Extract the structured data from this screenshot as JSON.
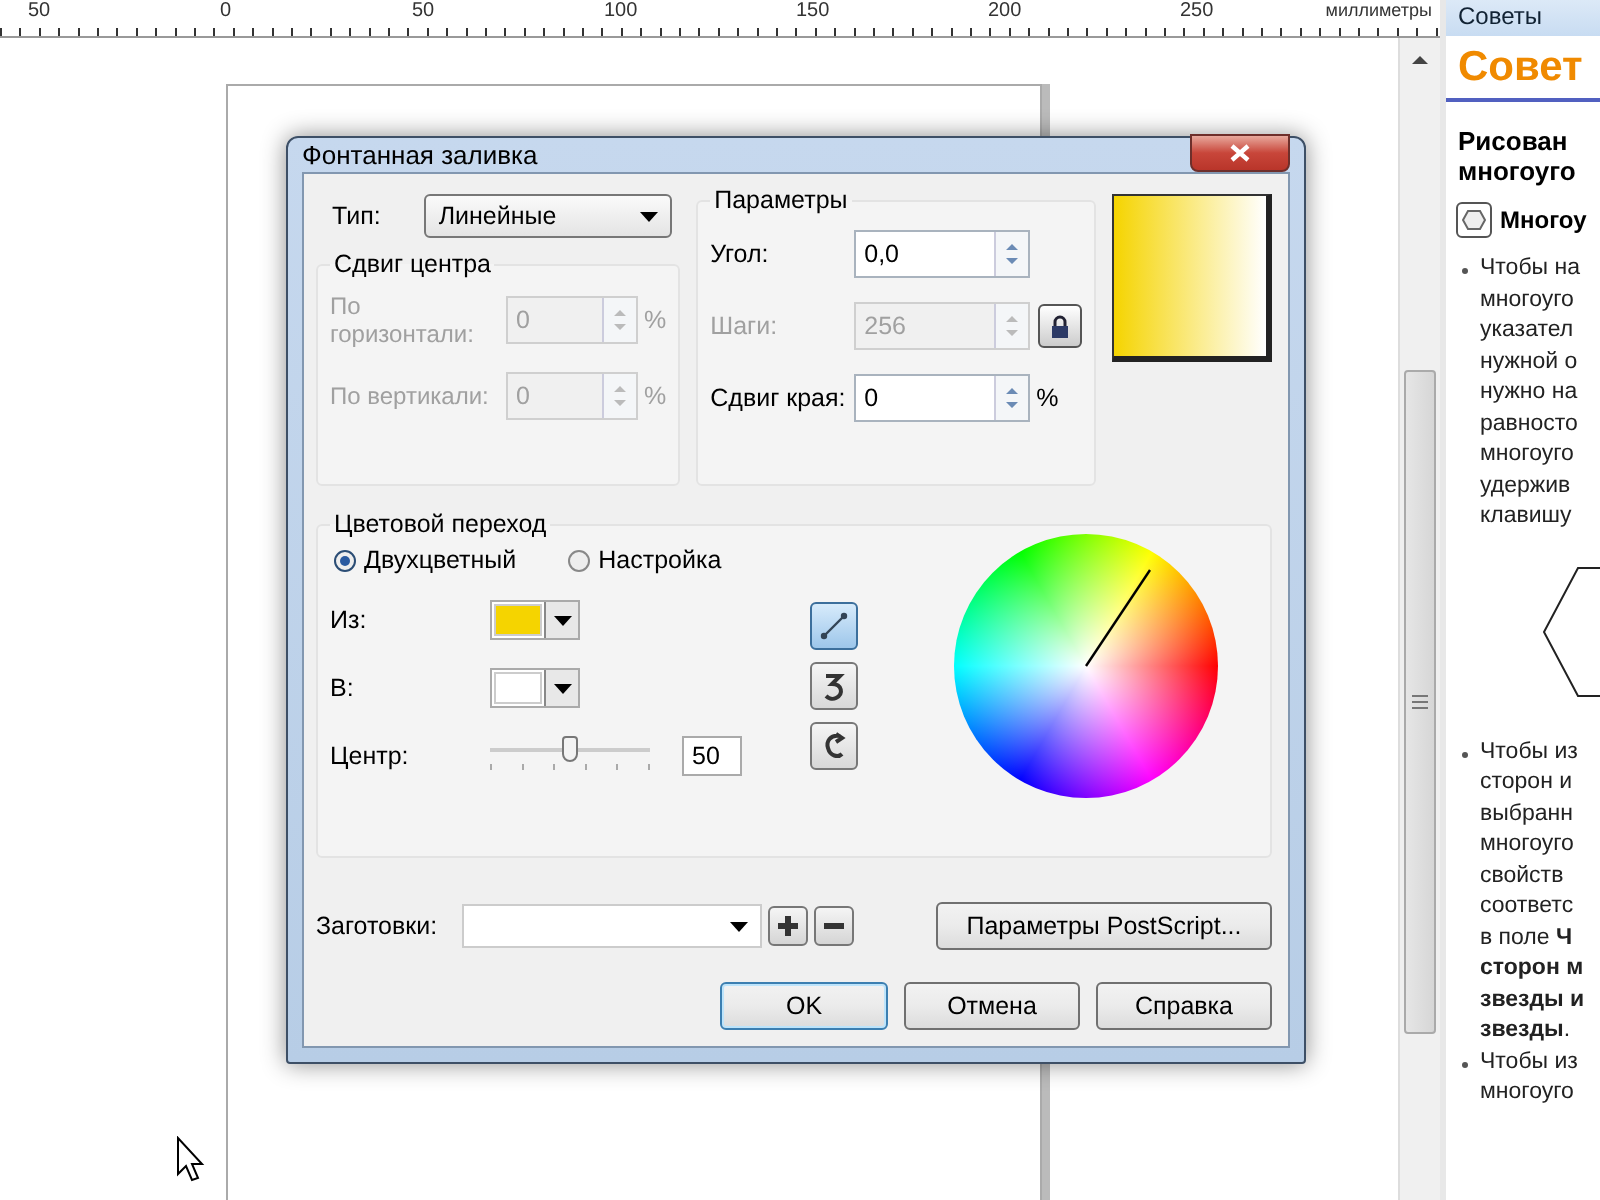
{
  "ruler": {
    "labels": [
      "50",
      "0",
      "50",
      "100",
      "150",
      "200",
      "250"
    ],
    "unit": "миллиметры"
  },
  "tips_panel": {
    "title": "Советы",
    "heading": "Совет",
    "subheading": [
      "Рисован",
      "многоуго"
    ],
    "tool": "Многоу",
    "bullets": [
      {
        "lines": [
          "Чтобы на",
          "многоуго",
          "указател",
          "нужной о",
          "нужно на",
          "равносто",
          "многоуго",
          "удержив",
          "клавишу"
        ]
      },
      {
        "lines": [
          "Чтобы из",
          "сторон и",
          "выбранн",
          "многоуго",
          "свойств",
          "соответс",
          "в поле **Ч**",
          "**сторон м**",
          "**звезды и**",
          "**звезды**."
        ]
      },
      {
        "lines": [
          "Чтобы из",
          "многоуго"
        ]
      }
    ]
  },
  "dialog": {
    "title": "Фонтанная заливка",
    "type": {
      "label": "Тип:",
      "value": "Линейные"
    },
    "center_offset": {
      "title": "Сдвиг центра",
      "fields": [
        {
          "label": "По горизонтали:",
          "value": "0",
          "unit": "%",
          "disabled": true
        },
        {
          "label": "По вертикали:",
          "value": "0",
          "unit": "%",
          "disabled": true
        }
      ]
    },
    "parameters": {
      "title": "Параметры",
      "fields": [
        {
          "kind": "spin",
          "label": "Угол:",
          "value": "0,0",
          "disabled": false
        },
        {
          "kind": "locked",
          "label": "Шаги:",
          "value": "256",
          "disabled": true
        },
        {
          "kind": "spin",
          "label": "Сдвиг края:",
          "value": "0",
          "unit": "%",
          "disabled": false
        }
      ]
    },
    "blend": {
      "title": "Цветовой переход",
      "modes": [
        {
          "label": "Двухцветный",
          "selected": true
        },
        {
          "label": "Настройка",
          "selected": false
        }
      ],
      "from": {
        "label": "Из:",
        "color": "#f5d400"
      },
      "to": {
        "label": "В:",
        "color": "#ffffff"
      },
      "center": {
        "label": "Центр:",
        "level": 0.5,
        "value": "50"
      },
      "directions": [
        {
          "kind": "line",
          "selected": true
        },
        {
          "kind": "clockwise",
          "selected": false
        },
        {
          "kind": "counterclockwise",
          "selected": false
        }
      ]
    },
    "presets": {
      "label": "Заготовки:"
    },
    "postscript_button": "Параметры PostScript...",
    "buttons": [
      {
        "label": "OK",
        "default": true
      },
      {
        "label": "Отмена",
        "default": false
      },
      {
        "label": "Справка",
        "default": false
      }
    ]
  }
}
